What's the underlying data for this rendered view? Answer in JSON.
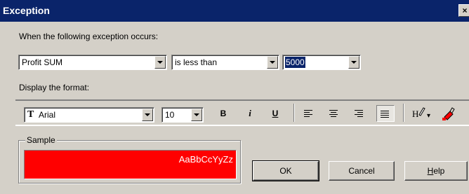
{
  "window": {
    "title": "Exception",
    "close_glyph": "×"
  },
  "exception": {
    "prompt": "When the following exception occurs:",
    "measure": "Profit SUM",
    "operator": "is less than",
    "value": "5000"
  },
  "format": {
    "prompt": "Display the format:",
    "font_icon": "truetype-font-icon",
    "font_icon_glyph": "T",
    "font": "Arial",
    "size": "10",
    "bold_label": "B",
    "italic_label": "i",
    "underline_label": "U",
    "more_glyph": "▾"
  },
  "sample": {
    "legend": "Sample",
    "text": "AaBbCcYyZz",
    "background": "#ff0000",
    "text_color": "#ffffff"
  },
  "buttons": {
    "ok": "OK",
    "cancel": "Cancel",
    "help_first": "H",
    "help_rest": "elp"
  },
  "colors": {
    "titlebar": "#0a246a",
    "face": "#d4d0c8"
  }
}
